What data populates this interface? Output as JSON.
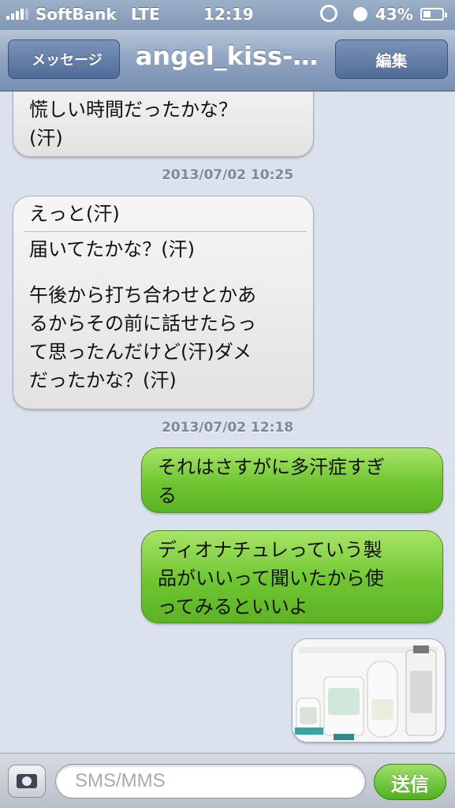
{
  "status_bar": {
    "carrier": "SoftBank",
    "network": "LTE",
    "time": "12:19",
    "battery_text": "43%",
    "battery_level": 0.43
  },
  "nav": {
    "back_label": "メッセージ",
    "title": "angel_kiss-…",
    "edit_label": "編集"
  },
  "messages": {
    "m1": {
      "lines": [
        "慌しい時間だったかな？",
        "(汗)"
      ]
    },
    "stamp1": "2013/07/02 10:25",
    "m2": {
      "first": "えっと(汗)",
      "lines": [
        "届いてたかな？(汗)",
        "",
        "午後から打ち合わせとかあ",
        "るからその前に話せたらっ",
        "て思ったんだけど(汗)ダメ",
        "だったかな？(汗)"
      ]
    },
    "stamp2": "2013/07/02 12:18",
    "m3": {
      "lines": [
        "それはさすがに多汗症すぎ",
        "る"
      ]
    },
    "m4": {
      "lines": [
        "ディオナチュレっていう製",
        "品がいいって聞いたから使",
        "ってみるといいよ"
      ]
    }
  },
  "input": {
    "placeholder": "SMS/MMS",
    "send_label": "送信"
  },
  "icons": {
    "camera": "camera-icon",
    "signal": "signal-bars-icon",
    "rotation_lock": "rotation-lock-icon",
    "alarm": "alarm-clock-icon",
    "battery": "battery-icon"
  },
  "colors": {
    "outgoing_bubble": "#6fc531",
    "incoming_bubble": "#ececec",
    "background": "#dbe2ed",
    "navbar": "#8ea3c1"
  }
}
